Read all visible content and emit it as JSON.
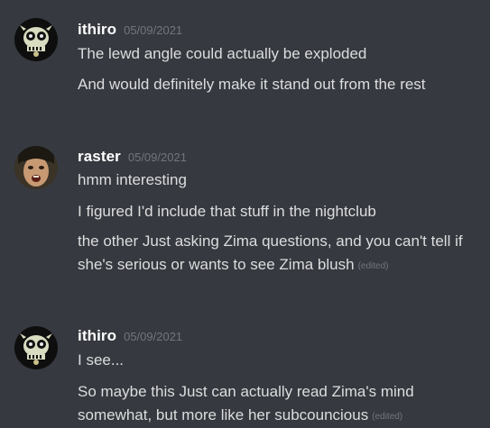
{
  "colors": {
    "background": "#36393f",
    "username": "#ffffff",
    "timestamp": "#72767d",
    "message_text": "#dcddde"
  },
  "messages": [
    {
      "username": "ithiro",
      "timestamp": "05/09/2021",
      "avatar_icon": "skull-mask-avatar",
      "lines": [
        {
          "text": "The lewd angle could actually be exploded",
          "edited": ""
        },
        {
          "text": "And would definitely make it stand out from the rest",
          "edited": ""
        }
      ]
    },
    {
      "username": "raster",
      "timestamp": "05/09/2021",
      "avatar_icon": "face-photo-avatar",
      "lines": [
        {
          "text": "hmm interesting",
          "edited": ""
        },
        {
          "text": "I figured I'd include that stuff in the nightclub",
          "edited": ""
        },
        {
          "text": "the other Just asking Zima questions, and you can't tell if she's serious or wants to see Zima blush",
          "edited": "(edited)"
        }
      ]
    },
    {
      "username": "ithiro",
      "timestamp": "05/09/2021",
      "avatar_icon": "skull-mask-avatar",
      "lines": [
        {
          "text": "I see...",
          "edited": ""
        },
        {
          "text": "So maybe this Just can actually read Zima's mind somewhat, but more like her subcouncious",
          "edited": "(edited)"
        }
      ]
    }
  ]
}
